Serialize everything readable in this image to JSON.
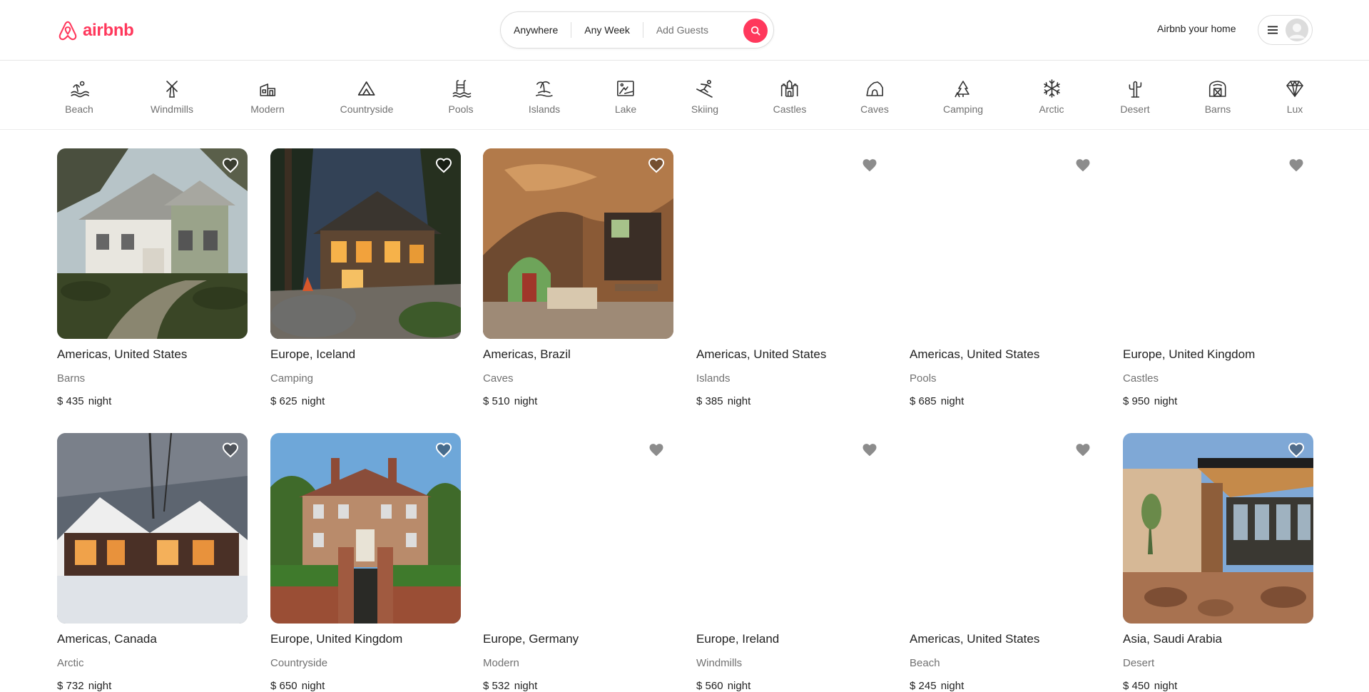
{
  "brand": {
    "name": "airbnb",
    "color": "#ff385c"
  },
  "search": {
    "location": "Anywhere",
    "week": "Any Week",
    "guests": "Add Guests",
    "icon": "search-icon"
  },
  "header_right": {
    "host_link": "Airbnb your home",
    "menu_icon": "hamburger-icon",
    "avatar_icon": "user-avatar-icon"
  },
  "categories": [
    {
      "label": "Beach",
      "icon": "beach-icon"
    },
    {
      "label": "Windmills",
      "icon": "windmill-icon"
    },
    {
      "label": "Modern",
      "icon": "modern-house-icon"
    },
    {
      "label": "Countryside",
      "icon": "countryside-icon"
    },
    {
      "label": "Pools",
      "icon": "pool-icon"
    },
    {
      "label": "Islands",
      "icon": "island-icon"
    },
    {
      "label": "Lake",
      "icon": "lake-icon"
    },
    {
      "label": "Skiing",
      "icon": "skiing-icon"
    },
    {
      "label": "Castles",
      "icon": "castle-icon"
    },
    {
      "label": "Caves",
      "icon": "cave-icon"
    },
    {
      "label": "Camping",
      "icon": "camping-icon"
    },
    {
      "label": "Arctic",
      "icon": "snowflake-icon"
    },
    {
      "label": "Desert",
      "icon": "cactus-icon"
    },
    {
      "label": "Barns",
      "icon": "barn-icon"
    },
    {
      "label": "Lux",
      "icon": "diamond-icon"
    }
  ],
  "listings": [
    {
      "location": "Americas, United States",
      "category": "Barns",
      "currency": "$",
      "price": "435",
      "unit": "night"
    },
    {
      "location": "Europe, Iceland",
      "category": "Camping",
      "currency": "$",
      "price": "625",
      "unit": "night"
    },
    {
      "location": "Americas, Brazil",
      "category": "Caves",
      "currency": "$",
      "price": "510",
      "unit": "night"
    },
    {
      "location": "Americas, United States",
      "category": "Islands",
      "currency": "$",
      "price": "385",
      "unit": "night"
    },
    {
      "location": "Americas, United States",
      "category": "Pools",
      "currency": "$",
      "price": "685",
      "unit": "night"
    },
    {
      "location": "Europe, United Kingdom",
      "category": "Castles",
      "currency": "$",
      "price": "950",
      "unit": "night"
    },
    {
      "location": "Americas, Canada",
      "category": "Arctic",
      "currency": "$",
      "price": "732",
      "unit": "night"
    },
    {
      "location": "Europe, United Kingdom",
      "category": "Countryside",
      "currency": "$",
      "price": "650",
      "unit": "night"
    },
    {
      "location": "Europe, Germany",
      "category": "Modern",
      "currency": "$",
      "price": "532",
      "unit": "night"
    },
    {
      "location": "Europe, Ireland",
      "category": "Windmills",
      "currency": "$",
      "price": "560",
      "unit": "night"
    },
    {
      "location": "Americas, United States",
      "category": "Beach",
      "currency": "$",
      "price": "245",
      "unit": "night"
    },
    {
      "location": "Asia, Saudi Arabia",
      "category": "Desert",
      "currency": "$",
      "price": "450",
      "unit": "night"
    }
  ]
}
